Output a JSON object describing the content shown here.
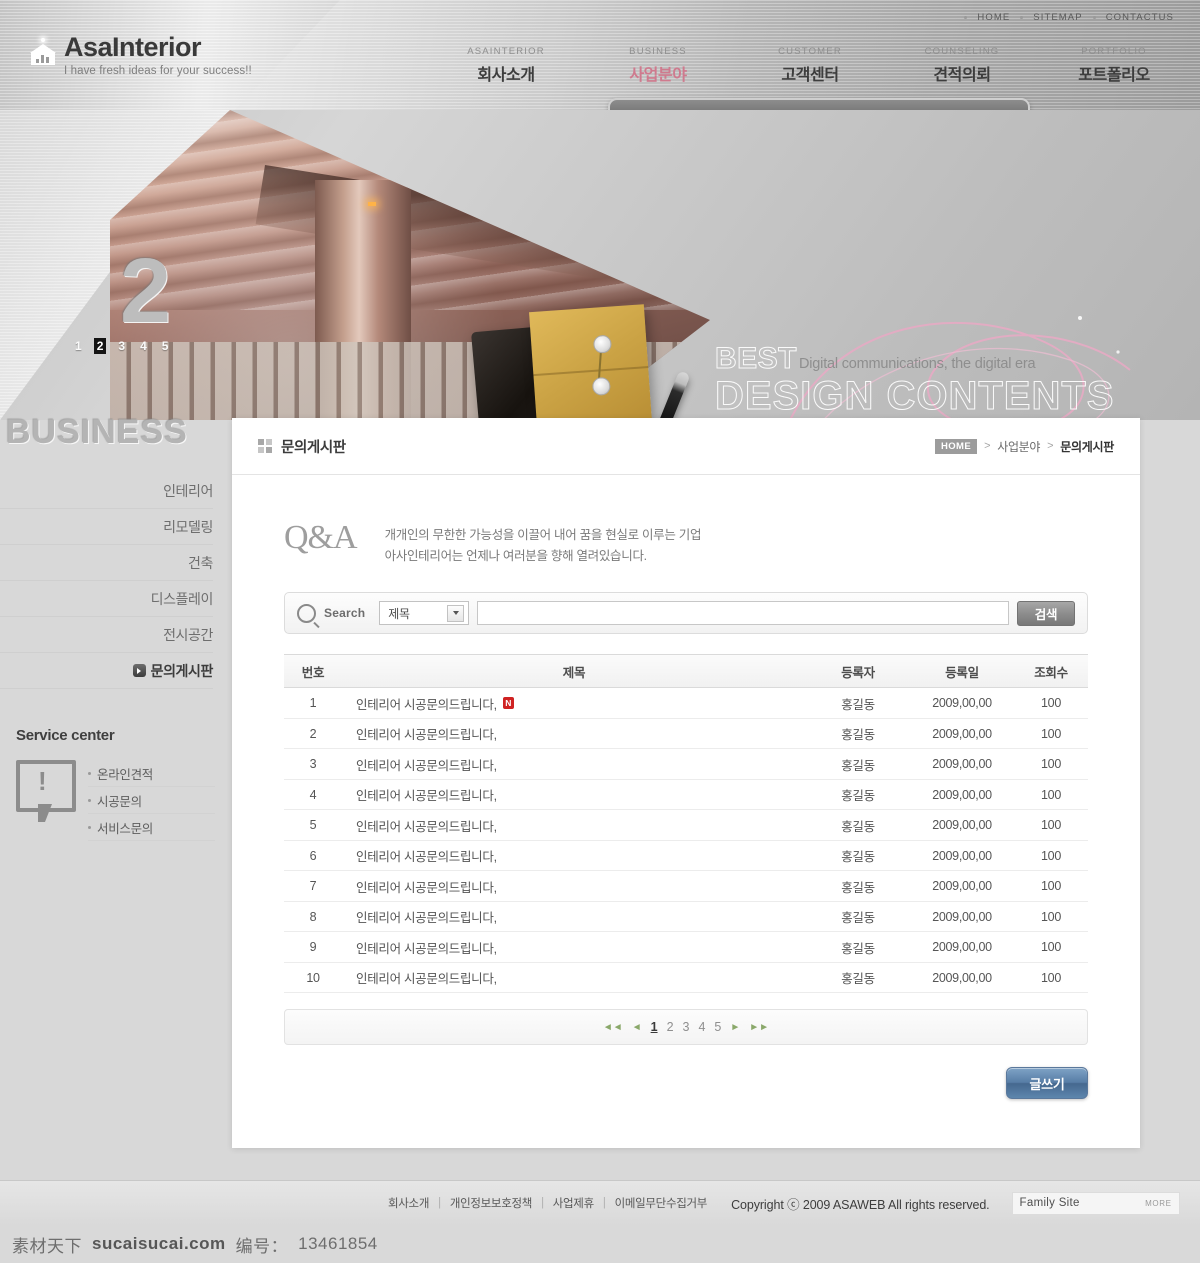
{
  "brand": {
    "name": "AsaInterior",
    "tagline": "I have fresh ideas for your success!!"
  },
  "topnav": [
    {
      "label": "HOME"
    },
    {
      "label": "SITEMAP"
    },
    {
      "label": "CONTACTUS"
    }
  ],
  "mainnav": [
    {
      "en": "ASAINTERIOR",
      "ko": "회사소개",
      "active": false
    },
    {
      "en": "BUSINESS",
      "ko": "사업분야",
      "active": true
    },
    {
      "en": "CUSTOMER",
      "ko": "고객센터",
      "active": false
    },
    {
      "en": "COUNSELING",
      "ko": "견적의뢰",
      "active": false
    },
    {
      "en": "PORTFOLIO",
      "ko": "포트폴리오",
      "active": false
    }
  ],
  "submenu": [
    "인테리어",
    "리모델링",
    "건축",
    "디스플레이",
    "전시공간",
    "문의게시판"
  ],
  "hero": {
    "slide_number": "2",
    "slides": [
      "1",
      "2",
      "3",
      "4",
      "5"
    ],
    "active_slide": "2",
    "best": "BEST",
    "subtitle": "Digital communications, the digital era",
    "headline": "DESIGN CONTENTS"
  },
  "sidebar": {
    "title": "BUSINESS",
    "items": [
      {
        "label": "인테리어",
        "active": false
      },
      {
        "label": "리모델링",
        "active": false
      },
      {
        "label": "건축",
        "active": false
      },
      {
        "label": "디스플레이",
        "active": false
      },
      {
        "label": "전시공간",
        "active": false
      },
      {
        "label": "문의게시판",
        "active": true
      }
    ],
    "service": {
      "title": "Service center",
      "links": [
        "온라인견적",
        "시공문의",
        "서비스문의"
      ]
    }
  },
  "content": {
    "page_title": "문의게시판",
    "breadcrumb": {
      "home": "HOME",
      "parent": "사업분야",
      "current": "문의게시판"
    },
    "qa": {
      "mark": "Q&A",
      "line1": "개개인의 무한한 가능성을 이끌어 내어 꿈을 현실로 이루는 기업",
      "line2": "아사인테리어는 언제나 여러분을 향해 열려있습니다."
    },
    "search": {
      "label": "Search",
      "select_value": "제목",
      "input_value": "",
      "input_placeholder": "",
      "button": "검색"
    },
    "table": {
      "headers": [
        "번호",
        "제목",
        "등록자",
        "등록일",
        "조회수"
      ],
      "rows": [
        {
          "no": "1",
          "title": "인테리어 시공문의드립니다,",
          "new": "N",
          "author": "홍길동",
          "date": "2009,00,00",
          "hits": "100"
        },
        {
          "no": "2",
          "title": "인테리어 시공문의드립니다,",
          "new": "",
          "author": "홍길동",
          "date": "2009,00,00",
          "hits": "100"
        },
        {
          "no": "3",
          "title": "인테리어 시공문의드립니다,",
          "new": "",
          "author": "홍길동",
          "date": "2009,00,00",
          "hits": "100"
        },
        {
          "no": "4",
          "title": "인테리어 시공문의드립니다,",
          "new": "",
          "author": "홍길동",
          "date": "2009,00,00",
          "hits": "100"
        },
        {
          "no": "5",
          "title": "인테리어 시공문의드립니다,",
          "new": "",
          "author": "홍길동",
          "date": "2009,00,00",
          "hits": "100"
        },
        {
          "no": "6",
          "title": "인테리어 시공문의드립니다,",
          "new": "",
          "author": "홍길동",
          "date": "2009,00,00",
          "hits": "100"
        },
        {
          "no": "7",
          "title": "인테리어 시공문의드립니다,",
          "new": "",
          "author": "홍길동",
          "date": "2009,00,00",
          "hits": "100"
        },
        {
          "no": "8",
          "title": "인테리어 시공문의드립니다,",
          "new": "",
          "author": "홍길동",
          "date": "2009,00,00",
          "hits": "100"
        },
        {
          "no": "9",
          "title": "인테리어 시공문의드립니다,",
          "new": "",
          "author": "홍길동",
          "date": "2009,00,00",
          "hits": "100"
        },
        {
          "no": "10",
          "title": "인테리어 시공문의드립니다,",
          "new": "",
          "author": "홍길동",
          "date": "2009,00,00",
          "hits": "100"
        }
      ]
    },
    "pagination": {
      "first": "◄◄",
      "prev": "◄",
      "pages": [
        "1",
        "2",
        "3",
        "4",
        "5"
      ],
      "active_page": "1",
      "next": "►",
      "last": "►►"
    },
    "write_button": "글쓰기"
  },
  "footer": {
    "links": [
      "회사소개",
      "개인정보보호정책",
      "사업제휴",
      "이메일무단수집거부"
    ],
    "copyright": "Copyright ⓒ 2009 ASAWEB  All rights reserved.",
    "family_site": "Family Site",
    "more": "MORE"
  },
  "watermark": {
    "cn": "素材天下",
    "site": "sucaisucai.com",
    "id_label": "编号：",
    "id": "13461854"
  },
  "colors": {
    "accent_pink": "#cf7a8e",
    "new_badge": "#cf2222",
    "write_button": "#577da6"
  }
}
